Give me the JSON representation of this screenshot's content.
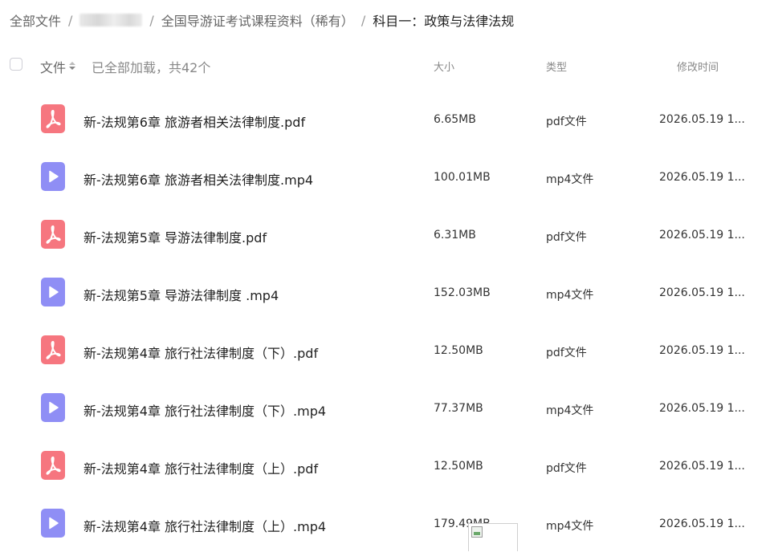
{
  "breadcrumb": {
    "items": [
      "全部文件",
      "",
      "全国导游证考试课程资料（稀有）",
      "科目一：政策与法律法规"
    ],
    "separator": "/"
  },
  "header": {
    "file_label": "文件",
    "loaded_text": "已全部加载，共42个",
    "size_label": "大小",
    "type_label": "类型",
    "date_label": "修改时间"
  },
  "files": [
    {
      "name": "新-法规第6章 旅游者相关法律制度.pdf",
      "size": "6.65MB",
      "type": "pdf文件",
      "date": "2026.05.19 1...",
      "icon": "pdf-icon"
    },
    {
      "name": "新-法规第6章 旅游者相关法律制度.mp4",
      "size": "100.01MB",
      "type": "mp4文件",
      "date": "2026.05.19 1...",
      "icon": "video-icon"
    },
    {
      "name": "新-法规第5章 导游法律制度.pdf",
      "size": "6.31MB",
      "type": "pdf文件",
      "date": "2026.05.19 1...",
      "icon": "pdf-icon"
    },
    {
      "name": "新-法规第5章 导游法律制度 .mp4",
      "size": "152.03MB",
      "type": "mp4文件",
      "date": "2026.05.19 1...",
      "icon": "video-icon"
    },
    {
      "name": "新-法规第4章 旅行社法律制度（下）.pdf",
      "size": "12.50MB",
      "type": "pdf文件",
      "date": "2026.05.19 1...",
      "icon": "pdf-icon"
    },
    {
      "name": "新-法规第4章 旅行社法律制度（下）.mp4",
      "size": "77.37MB",
      "type": "mp4文件",
      "date": "2026.05.19 1...",
      "icon": "video-icon"
    },
    {
      "name": "新-法规第4章 旅行社法律制度（上）.pdf",
      "size": "12.50MB",
      "type": "pdf文件",
      "date": "2026.05.19 1...",
      "icon": "pdf-icon"
    },
    {
      "name": "新-法规第4章 旅行社法律制度（上）.mp4",
      "size": "179.49MB",
      "type": "mp4文件",
      "date": "2026.05.19 1...",
      "icon": "video-icon"
    }
  ],
  "colors": {
    "pdf_icon": "#f6767f",
    "video_icon": "#8f8ef5",
    "muted_text": "#888888",
    "primary_text": "#222222"
  }
}
